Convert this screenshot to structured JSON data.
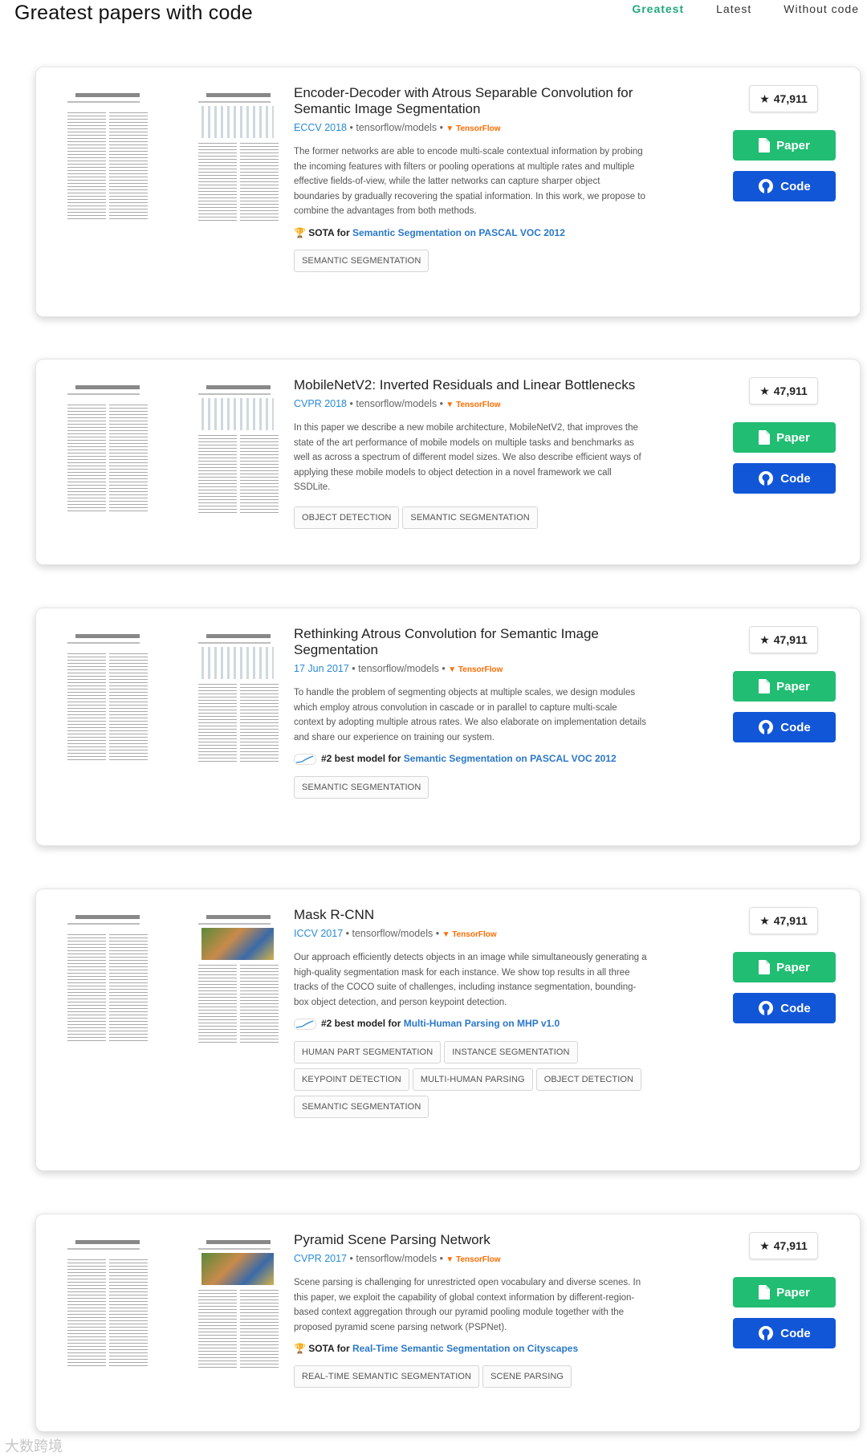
{
  "header": {
    "title": "Greatest papers with code",
    "tabs": [
      {
        "label": "Greatest",
        "active": true
      },
      {
        "label": "Latest",
        "active": false
      },
      {
        "label": "Without code",
        "active": false
      }
    ]
  },
  "colors": {
    "accent_green": "#20a97a",
    "paper_button": "#21bd73",
    "code_button": "#1256d8",
    "link_blue": "#2a8bd6"
  },
  "papers": [
    {
      "title": "Encoder-Decoder with Atrous Separable Convolution for Semantic Image Segmentation",
      "venue": "ECCV 2018",
      "repo": "tensorflow/models",
      "framework": "TensorFlow",
      "abstract": "The former networks are able to encode multi-scale contextual information by probing the incoming features with filters or pooling operations at multiple rates and multiple effective fields-of-view, while the latter networks can capture sharper object boundaries by gradually recovering the spatial information. In this work, we propose to combine the advantages from both methods.",
      "sota_prefix": "SOTA for",
      "sota_task": "Semantic Segmentation on PASCAL VOC 2012",
      "sota_icon": "trophy-icon",
      "tags": [
        "SEMANTIC SEGMENTATION"
      ],
      "stars": "47,911",
      "paper_label": "Paper",
      "code_label": "Code"
    },
    {
      "title": "MobileNetV2: Inverted Residuals and Linear Bottlenecks",
      "venue": "CVPR 2018",
      "repo": "tensorflow/models",
      "framework": "TensorFlow",
      "abstract": "In this paper we describe a new mobile architecture, MobileNetV2, that improves the state of the art performance of mobile models on multiple tasks and benchmarks as well as across a spectrum of different model sizes. We also describe efficient ways of applying these mobile models to object detection in a novel framework we call SSDLite.",
      "tags": [
        "OBJECT DETECTION",
        "SEMANTIC SEGMENTATION"
      ],
      "stars": "47,911",
      "paper_label": "Paper",
      "code_label": "Code"
    },
    {
      "title": "Rethinking Atrous Convolution for Semantic Image Segmentation",
      "venue": "17 Jun 2017",
      "repo": "tensorflow/models",
      "framework": "TensorFlow",
      "abstract": "To handle the problem of segmenting objects at multiple scales, we design modules which employ atrous convolution in cascade or in parallel to capture multi-scale context by adopting multiple atrous rates. We also elaborate on implementation details and share our experience on training our system.",
      "sota_prefix": "#2 best model for",
      "sota_task": "Semantic Segmentation on PASCAL VOC 2012",
      "sota_icon": "sparkline-icon",
      "tags": [
        "SEMANTIC SEGMENTATION"
      ],
      "stars": "47,911",
      "paper_label": "Paper",
      "code_label": "Code"
    },
    {
      "title": "Mask R-CNN",
      "venue": "ICCV 2017",
      "repo": "tensorflow/models",
      "framework": "TensorFlow",
      "abstract": "Our approach efficiently detects objects in an image while simultaneously generating a high-quality segmentation mask for each instance. We show top results in all three tracks of the COCO suite of challenges, including instance segmentation, bounding-box object detection, and person keypoint detection.",
      "sota_prefix": "#2 best model for",
      "sota_task": "Multi-Human Parsing on MHP v1.0",
      "sota_icon": "sparkline-icon",
      "tags": [
        "HUMAN PART SEGMENTATION",
        "INSTANCE SEGMENTATION",
        "KEYPOINT DETECTION",
        "MULTI-HUMAN PARSING",
        "OBJECT DETECTION",
        "SEMANTIC SEGMENTATION"
      ],
      "stars": "47,911",
      "paper_label": "Paper",
      "code_label": "Code"
    },
    {
      "title": "Pyramid Scene Parsing Network",
      "venue": "CVPR 2017",
      "repo": "tensorflow/models",
      "framework": "TensorFlow",
      "abstract": "Scene parsing is challenging for unrestricted open vocabulary and diverse scenes. In this paper, we exploit the capability of global context information by different-region-based context aggregation through our pyramid pooling module together with the proposed pyramid scene parsing network (PSPNet).",
      "sota_prefix": "SOTA for",
      "sota_task": "Real-Time Semantic Segmentation on Cityscapes",
      "sota_icon": "trophy-icon",
      "tags": [
        "REAL-TIME SEMANTIC SEGMENTATION",
        "SCENE PARSING"
      ],
      "stars": "47,911",
      "paper_label": "Paper",
      "code_label": "Code"
    }
  ],
  "watermark": "大数跨境"
}
